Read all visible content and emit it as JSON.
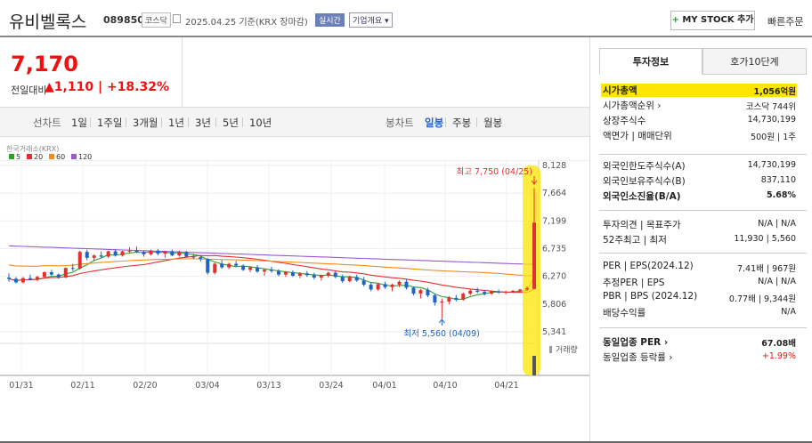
{
  "header": {
    "stock_name": "유비벨록스",
    "stock_code": "089850",
    "market": "코스닥",
    "date_text": "2025.04.25  기준(KRX 장마감)",
    "realtime_label": "실시간",
    "overview_label": "기업개요 ▾",
    "mystock_label": "MY STOCK 추가",
    "quick_order_label": "빠른주문 "
  },
  "quote": {
    "price": "7,170",
    "change_label": "전일대비",
    "change_arrow": "▲",
    "change_value": "1,110",
    "change_pct": "+18.32%"
  },
  "chart_tabs": {
    "line_label": "선차트",
    "periods": [
      "1일",
      "1주일",
      "3개월",
      "1년",
      "3년",
      "5년",
      "10년"
    ],
    "candle_label": "봉차트",
    "candle_periods": [
      "일봉",
      "주봉",
      "월봉"
    ],
    "active_candle_period": "일봉"
  },
  "chart_data": {
    "type": "candlestick",
    "exchange_label": "한국거래소(KRX)",
    "legend": [
      {
        "name": "5",
        "color": "#2ca02c"
      },
      {
        "name": "20",
        "color": "#e03030"
      },
      {
        "name": "60",
        "color": "#f08c1e"
      },
      {
        "name": "120",
        "color": "#9b59d0"
      }
    ],
    "y_ticks": [
      "8,128",
      "7,664",
      "7,199",
      "6,735",
      "6,270",
      "5,806",
      "5,341"
    ],
    "ylim": [
      5341,
      8128
    ],
    "x_ticks": [
      "01/31",
      "02/11",
      "02/20",
      "03/04",
      "03/13",
      "03/24",
      "04/01",
      "04/10",
      "04/21"
    ],
    "high_annotation": "최고 7,750 (04/25)",
    "low_annotation": "최저 5,560 (04/09)",
    "volume_label": "거래량",
    "candles": [
      [
        6250,
        6320,
        6180,
        6230
      ],
      [
        6230,
        6260,
        6150,
        6170
      ],
      [
        6170,
        6260,
        6150,
        6240
      ],
      [
        6240,
        6300,
        6200,
        6210
      ],
      [
        6210,
        6280,
        6190,
        6260
      ],
      [
        6260,
        6350,
        6230,
        6340
      ],
      [
        6340,
        6380,
        6280,
        6300
      ],
      [
        6300,
        6320,
        6230,
        6250
      ],
      [
        6250,
        6420,
        6240,
        6410
      ],
      [
        6410,
        6480,
        6360,
        6400
      ],
      [
        6400,
        6700,
        6380,
        6680
      ],
      [
        6680,
        6720,
        6540,
        6580
      ],
      [
        6580,
        6640,
        6520,
        6620
      ],
      [
        6620,
        6690,
        6580,
        6600
      ],
      [
        6600,
        6700,
        6580,
        6690
      ],
      [
        6690,
        6720,
        6600,
        6620
      ],
      [
        6620,
        6700,
        6600,
        6690
      ],
      [
        6690,
        6760,
        6650,
        6700
      ],
      [
        6700,
        6770,
        6660,
        6680
      ],
      [
        6680,
        6700,
        6600,
        6640
      ],
      [
        6640,
        6720,
        6620,
        6700
      ],
      [
        6700,
        6730,
        6620,
        6650
      ],
      [
        6650,
        6700,
        6580,
        6690
      ],
      [
        6690,
        6720,
        6610,
        6620
      ],
      [
        6620,
        6700,
        6600,
        6680
      ],
      [
        6680,
        6700,
        6580,
        6600
      ],
      [
        6600,
        6640,
        6560,
        6590
      ],
      [
        6590,
        6620,
        6520,
        6560
      ],
      [
        6560,
        6580,
        6300,
        6330
      ],
      [
        6330,
        6500,
        6300,
        6480
      ],
      [
        6480,
        6540,
        6400,
        6420
      ],
      [
        6420,
        6500,
        6390,
        6480
      ],
      [
        6480,
        6530,
        6430,
        6450
      ],
      [
        6450,
        6470,
        6360,
        6380
      ],
      [
        6380,
        6440,
        6340,
        6420
      ],
      [
        6420,
        6460,
        6330,
        6350
      ],
      [
        6350,
        6400,
        6280,
        6380
      ],
      [
        6380,
        6430,
        6330,
        6360
      ],
      [
        6360,
        6390,
        6270,
        6300
      ],
      [
        6300,
        6360,
        6260,
        6340
      ],
      [
        6340,
        6370,
        6260,
        6280
      ],
      [
        6280,
        6340,
        6240,
        6320
      ],
      [
        6320,
        6360,
        6260,
        6290
      ],
      [
        6290,
        6330,
        6220,
        6250
      ],
      [
        6250,
        6300,
        6200,
        6280
      ],
      [
        6280,
        6350,
        6250,
        6330
      ],
      [
        6330,
        6360,
        6240,
        6260
      ],
      [
        6260,
        6300,
        6160,
        6190
      ],
      [
        6190,
        6280,
        6170,
        6260
      ],
      [
        6260,
        6300,
        6180,
        6200
      ],
      [
        6200,
        6260,
        6100,
        6130
      ],
      [
        6130,
        6160,
        6020,
        6050
      ],
      [
        6050,
        6160,
        6030,
        6140
      ],
      [
        6140,
        6180,
        6060,
        6090
      ],
      [
        6090,
        6150,
        6020,
        6130
      ],
      [
        6130,
        6200,
        6090,
        6180
      ],
      [
        6180,
        6220,
        6050,
        6080
      ],
      [
        6080,
        6100,
        5950,
        5980
      ],
      [
        5980,
        6060,
        5900,
        6040
      ],
      [
        6040,
        6080,
        5920,
        5950
      ],
      [
        5950,
        5980,
        5780,
        5830
      ],
      [
        5830,
        5900,
        5560,
        5850
      ],
      [
        5850,
        5940,
        5800,
        5910
      ],
      [
        5910,
        5960,
        5850,
        5880
      ],
      [
        5880,
        6000,
        5860,
        5980
      ],
      [
        5980,
        6050,
        5950,
        6030
      ],
      [
        6030,
        6080,
        5990,
        6010
      ],
      [
        6010,
        6040,
        5950,
        5980
      ],
      [
        5980,
        6030,
        5960,
        6020
      ],
      [
        6020,
        6050,
        5980,
        6000
      ],
      [
        6000,
        6030,
        5970,
        6010
      ],
      [
        6010,
        6040,
        5990,
        6030
      ],
      [
        6030,
        6060,
        6000,
        6050
      ],
      [
        6050,
        6100,
        6030,
        6070
      ],
      [
        6060,
        7750,
        6050,
        7170
      ]
    ]
  },
  "side_tabs": {
    "invest_info": "투자정보",
    "order_book": "호가10단계"
  },
  "invest_rows_1": [
    {
      "label": "시가총액",
      "value": "1,056억원",
      "bold": true
    },
    {
      "label": "시가총액순위 ›",
      "value": "코스닥 744위"
    },
    {
      "label": "상장주식수",
      "value": "14,730,199"
    },
    {
      "label": "액면가 | 매매단위",
      "value": "500원 | 1주"
    }
  ],
  "invest_rows_2": [
    {
      "label": "외국인한도주식수(A)",
      "value": "14,730,199"
    },
    {
      "label": "외국인보유주식수(B)",
      "value": "837,110"
    },
    {
      "label": "외국인소진율(B/A)",
      "value": "5.68%",
      "bold": true
    }
  ],
  "invest_rows_3": [
    {
      "label": "투자의견 | 목표주가",
      "value": "N/A | N/A"
    },
    {
      "label": "52주최고 | 최저",
      "value": "11,930 | 5,560"
    }
  ],
  "invest_rows_4": [
    {
      "label": "PER | EPS(2024.12)",
      "value": "7.41배 | 967원"
    },
    {
      "label": "추정PER | EPS",
      "value": "N/A | N/A"
    },
    {
      "label": "PBR | BPS (2024.12)",
      "value": "0.77배 | 9,344원"
    },
    {
      "label": "배당수익률",
      "value": "N/A"
    }
  ],
  "invest_rows_5": [
    {
      "label": "동일업종 PER ›",
      "value": "67.08배",
      "bold": true
    },
    {
      "label": "동일업종 등락률 ›",
      "value": "+1.99%",
      "red": true
    }
  ]
}
